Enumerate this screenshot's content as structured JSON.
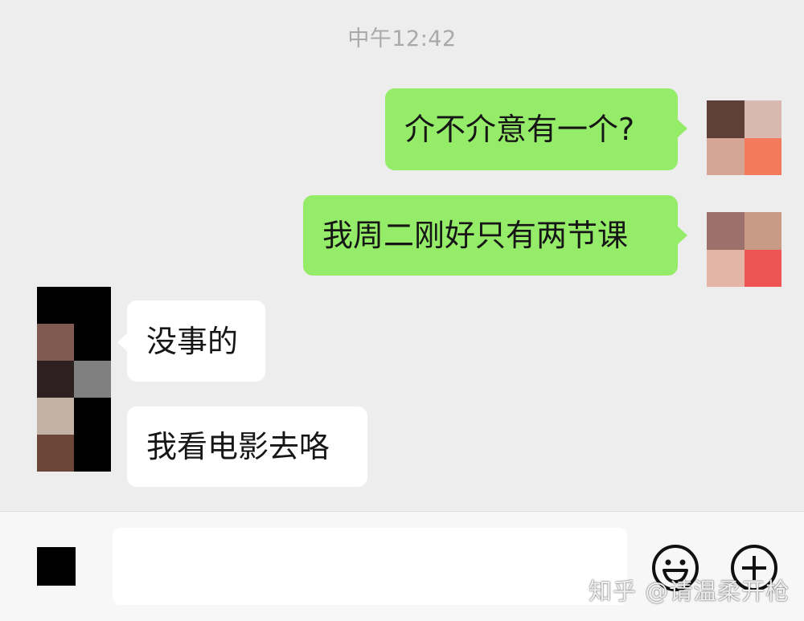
{
  "chat": {
    "timestamp": "中午12:42",
    "messages": [
      {
        "side": "out",
        "text": "介不介意有一个?"
      },
      {
        "side": "out",
        "text": "我周二刚好只有两节课"
      },
      {
        "side": "in",
        "text": "没事的"
      },
      {
        "side": "in",
        "text": "我看电影去咯"
      }
    ]
  },
  "avatars": {
    "self_1": [
      "#5e4039",
      "#d8b8b0",
      "#d6a694",
      "#f37a5c"
    ],
    "self_2": [
      "#9c706b",
      "#c99a86",
      "#e4b5a6",
      "#ee5454"
    ],
    "contact": [
      "#000000",
      "#000000",
      "#805951",
      "#000000",
      "#2c2020",
      "#808080",
      "#c3b2a6",
      "#000000",
      "#6c4639",
      "#000000"
    ]
  },
  "input_bar": {
    "placeholder": "",
    "emoji_icon": "emoji-icon",
    "plus_icon": "plus-icon",
    "voice_icon": "voice-icon"
  },
  "watermark": {
    "text": "知乎 @请温柔开枪"
  }
}
